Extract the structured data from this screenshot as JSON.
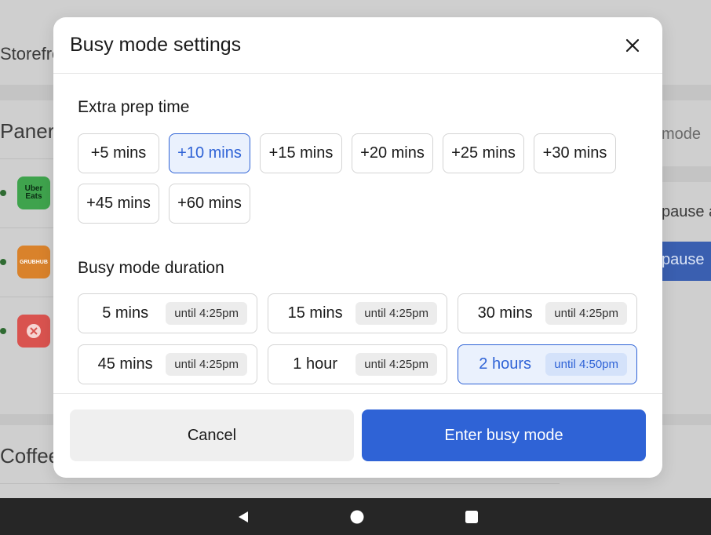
{
  "background": {
    "storefront_label": "Storefro",
    "panera_label": "Panera",
    "coffee_label": "Coffee",
    "busy_mode_label": "mode",
    "pause_text": "pause a",
    "pause_button": "pause",
    "logos": [
      {
        "name": "Uber Eats",
        "text": "Uber Eats",
        "color": "#3fa34d"
      },
      {
        "name": "Grubhub",
        "text": "GRUBHUB",
        "color": "#d9822b"
      },
      {
        "name": "DoorDash",
        "text": "",
        "color": "#d9534f"
      }
    ]
  },
  "modal": {
    "title": "Busy mode settings",
    "close_icon": "close-icon",
    "prep": {
      "title": "Extra prep time",
      "options": [
        "+5 mins",
        "+10 mins",
        "+15 mins",
        "+20 mins",
        "+25 mins",
        "+30 mins",
        "+45 mins",
        "+60 mins"
      ],
      "selected": "+10 mins"
    },
    "duration": {
      "title": "Busy mode duration",
      "options": [
        {
          "label": "5 mins",
          "until": "until 4:25pm"
        },
        {
          "label": "15 mins",
          "until": "until 4:25pm"
        },
        {
          "label": "30 mins",
          "until": "until 4:25pm"
        },
        {
          "label": "45 mins",
          "until": "until 4:25pm"
        },
        {
          "label": "1 hour",
          "until": "until 4:25pm"
        },
        {
          "label": "2 hours",
          "until": "until 4:50pm"
        }
      ],
      "selected": "2 hours"
    },
    "footer": {
      "cancel_label": "Cancel",
      "confirm_label": "Enter busy mode"
    }
  },
  "colors": {
    "accent": "#2f63d6",
    "selected_bg": "#eaf1fd",
    "nav_bar": "#262626"
  },
  "navbar": {
    "icons": [
      "back-icon",
      "home-icon",
      "recents-icon"
    ]
  }
}
